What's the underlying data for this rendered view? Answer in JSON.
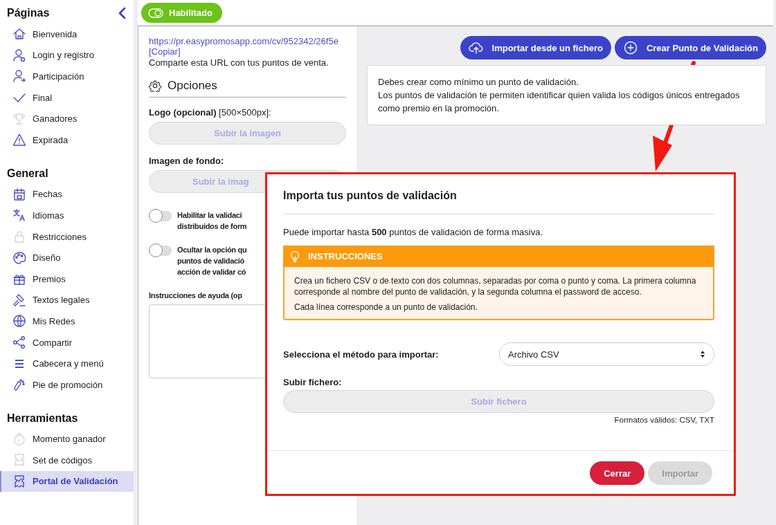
{
  "top_bar": {
    "status_badge": {
      "label": "Habilitado",
      "on": true
    }
  },
  "sidebar": {
    "sections": [
      {
        "title": "Páginas",
        "items": [
          {
            "label": "Bienvenida",
            "disabled": false,
            "selected": false
          },
          {
            "label": "Login y registro",
            "disabled": false,
            "selected": false
          },
          {
            "label": "Participación",
            "disabled": false,
            "selected": false
          },
          {
            "label": "Final",
            "disabled": false,
            "selected": false
          },
          {
            "label": "Ganadores",
            "disabled": true,
            "selected": false
          },
          {
            "label": "Expirada",
            "disabled": false,
            "selected": false
          }
        ]
      },
      {
        "title": "General",
        "items": [
          {
            "label": "Fechas",
            "disabled": false,
            "selected": false
          },
          {
            "label": "Idiomas",
            "disabled": false,
            "selected": false
          },
          {
            "label": "Restricciones",
            "disabled": true,
            "selected": false
          },
          {
            "label": "Diseño",
            "disabled": false,
            "selected": false
          },
          {
            "label": "Premios",
            "disabled": false,
            "selected": false
          },
          {
            "label": "Textos legales",
            "disabled": false,
            "selected": false
          },
          {
            "label": "Mis Redes",
            "disabled": false,
            "selected": false
          },
          {
            "label": "Compartir",
            "disabled": false,
            "selected": false
          },
          {
            "label": "Cabecera y menú",
            "disabled": false,
            "selected": false
          },
          {
            "label": "Pie de promoción",
            "disabled": false,
            "selected": false
          }
        ]
      },
      {
        "title": "Herramientas",
        "items": [
          {
            "label": "Momento ganador",
            "disabled": true,
            "selected": false
          },
          {
            "label": "Set de códigos",
            "disabled": true,
            "selected": false
          },
          {
            "label": "Portal de Validación",
            "disabled": false,
            "selected": true
          }
        ]
      }
    ]
  },
  "settings": {
    "url": "https://pr.easypromosapp.com/cv/952342/26f5e",
    "copy_link": "[Copiar]",
    "url_note": "Comparte esta URL con tus puntos de venta.",
    "options_title": "Opciones",
    "logo_label": "**Logo (opcional)** [500×500px]:",
    "logo_button": "Subir la imagen",
    "background_label": "Imagen de fondo:",
    "background_button": "Subir la imag",
    "toggles": [
      {
        "lines": [
          "Habilitar la validaci",
          "distribuidos de form"
        ],
        "on": false
      },
      {
        "lines": [
          "Ocultar la opción qu",
          "puntos de validació",
          "acción de validar có"
        ],
        "on": false
      }
    ],
    "help_label": "Instrucciones de ayuda (op"
  },
  "validation_points": {
    "buttons": [
      "Importar desde un fichero",
      "Crear Punto de Validación"
    ],
    "notice": [
      "Debes crear como mínimo un punto de validación.",
      "Los puntos de validación te permiten identificar quien valida los códigos únicos entregados como premio en la promoción."
    ]
  },
  "modal": {
    "title": "Importa tus puntos de validación",
    "intro": "Puede importar hasta **500** puntos de validación de forma masiva.",
    "instructions": {
      "title": "INSTRUCCIONES",
      "paragraphs": [
        "Crea un fichero CSV o de texto con dos columnas, separadas por coma o punto y coma. La primera columna corresponde al nombre del punto de validación, y la segunda columna el password de acceso.",
        "Cada línea corresponde a un punto de validación."
      ]
    },
    "method_label": "Selecciona el método para importar:",
    "method_value": "Archivo CSV",
    "upload_label": "Subir fichero:",
    "upload_button": "Subir fichero",
    "formats": "Formatos válidos: CSV, TXT",
    "actions": [
      {
        "label": "Cerrar",
        "disabled": false
      },
      {
        "label": "Importar",
        "disabled": true
      }
    ]
  }
}
